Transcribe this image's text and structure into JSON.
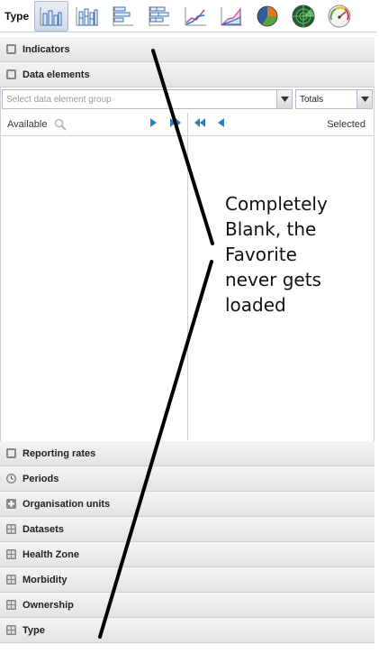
{
  "toolbar": {
    "type_label": "Type",
    "chart_types": [
      {
        "icon": "column-chart-icon",
        "active": true
      },
      {
        "icon": "stacked-column-chart-icon",
        "active": false
      },
      {
        "icon": "bar-chart-icon",
        "active": false
      },
      {
        "icon": "stacked-bar-chart-icon",
        "active": false
      },
      {
        "icon": "line-chart-icon",
        "active": false
      },
      {
        "icon": "area-chart-icon",
        "active": false
      },
      {
        "icon": "pie-chart-icon",
        "active": false
      },
      {
        "icon": "radar-chart-icon",
        "active": false
      },
      {
        "icon": "gauge-chart-icon",
        "active": false
      }
    ]
  },
  "sections_top": [
    {
      "label": "Indicators",
      "icon": "indicator-icon"
    },
    {
      "label": "Data elements",
      "icon": "data-element-icon"
    }
  ],
  "data_elements": {
    "group_placeholder": "Select data element group",
    "detail_value": "Totals",
    "available_label": "Available",
    "selected_label": "Selected"
  },
  "sections_bottom": [
    {
      "label": "Reporting rates",
      "icon": "reporting-rate-icon"
    },
    {
      "label": "Periods",
      "icon": "clock-icon"
    },
    {
      "label": "Organisation units",
      "icon": "plus-icon"
    },
    {
      "label": "Datasets",
      "icon": "grid-icon"
    },
    {
      "label": "Health Zone",
      "icon": "grid-icon"
    },
    {
      "label": "Morbidity",
      "icon": "grid-icon"
    },
    {
      "label": "Ownership",
      "icon": "grid-icon"
    },
    {
      "label": "Type",
      "icon": "grid-icon"
    }
  ],
  "annotation": {
    "lines": [
      "Completely",
      "Blank, the",
      "Favorite",
      "never gets",
      "loaded"
    ]
  },
  "colors": {
    "accent_blue": "#2a7fc9",
    "header_gradient_top": "#f4f4f4",
    "header_gradient_bottom": "#e3e3e3"
  }
}
